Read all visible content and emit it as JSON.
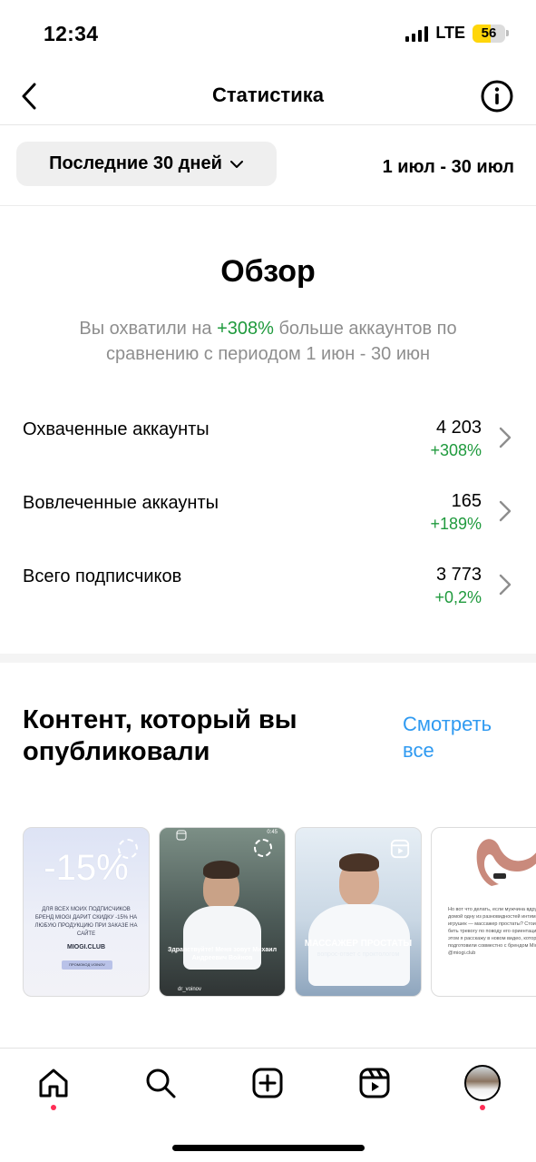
{
  "status_bar": {
    "time": "12:34",
    "network": "LTE",
    "battery": "56",
    "battery_level": 0.56,
    "battery_color": "#ffd60a"
  },
  "header": {
    "title": "Статистика",
    "back_icon": "chevron-left-icon",
    "info_icon": "info-circle-icon"
  },
  "filter": {
    "period_label": "Последние 30 дней",
    "date_range": "1 июл - 30 июл"
  },
  "overview": {
    "title": "Обзор",
    "subtitle_prefix": "Вы охватили на ",
    "subtitle_highlight": "+308%",
    "subtitle_suffix": " больше аккаунтов по сравнению с периодом 1 июн - 30 июн",
    "metrics": [
      {
        "label": "Охваченные аккаунты",
        "value": "4 203",
        "delta": "+308%"
      },
      {
        "label": "Вовлеченные аккаунты",
        "value": "165",
        "delta": "+189%"
      },
      {
        "label": "Всего подписчиков",
        "value": "3 773",
        "delta": "+0,2%"
      }
    ]
  },
  "content": {
    "title": "Контент, который вы опубликовали",
    "see_all": "Смотреть все",
    "posts": [
      {
        "big": "-15%",
        "text": "ДЛЯ ВСЕХ МОИХ ПОДПИСЧИКОВ БРЕНД MIOGI ДАРИТ СКИДКУ -15% НА ЛЮБУЮ ПРОДУКЦИЮ ПРИ ЗАКАЗЕ НА САЙТЕ",
        "brand": "MIOGI.CLUB",
        "code": "ПРОМОКОД VOINOV"
      },
      {
        "duration": "0:45",
        "caption": "Здравствуйте! Меня зовут Михаил Андреевич Войнов",
        "handle": "dr_voinov"
      },
      {
        "caption": "МАССАЖЕР ПРОСТАТЫ",
        "sub": "вопрос-ответ с проктологом"
      },
      {
        "text": "Но вот что делать, если мужчина вдруг принес домой одну из разновидностей интимных игрушек — массажер простаты? Стоит ли бить тревогу по поводу его ориентации? Об этом я расскажу в новом видео, которое мы подготовили совместно с брендом Miogi @miogi.club"
      }
    ]
  },
  "tabbar": {
    "tabs": [
      "home-icon",
      "search-icon",
      "create-icon",
      "reels-icon",
      "profile-avatar"
    ],
    "notification_color": "#ff2d55"
  },
  "colors": {
    "positive": "#1f9a3d",
    "link": "#2f9af1",
    "muted": "#8e8e8e"
  }
}
